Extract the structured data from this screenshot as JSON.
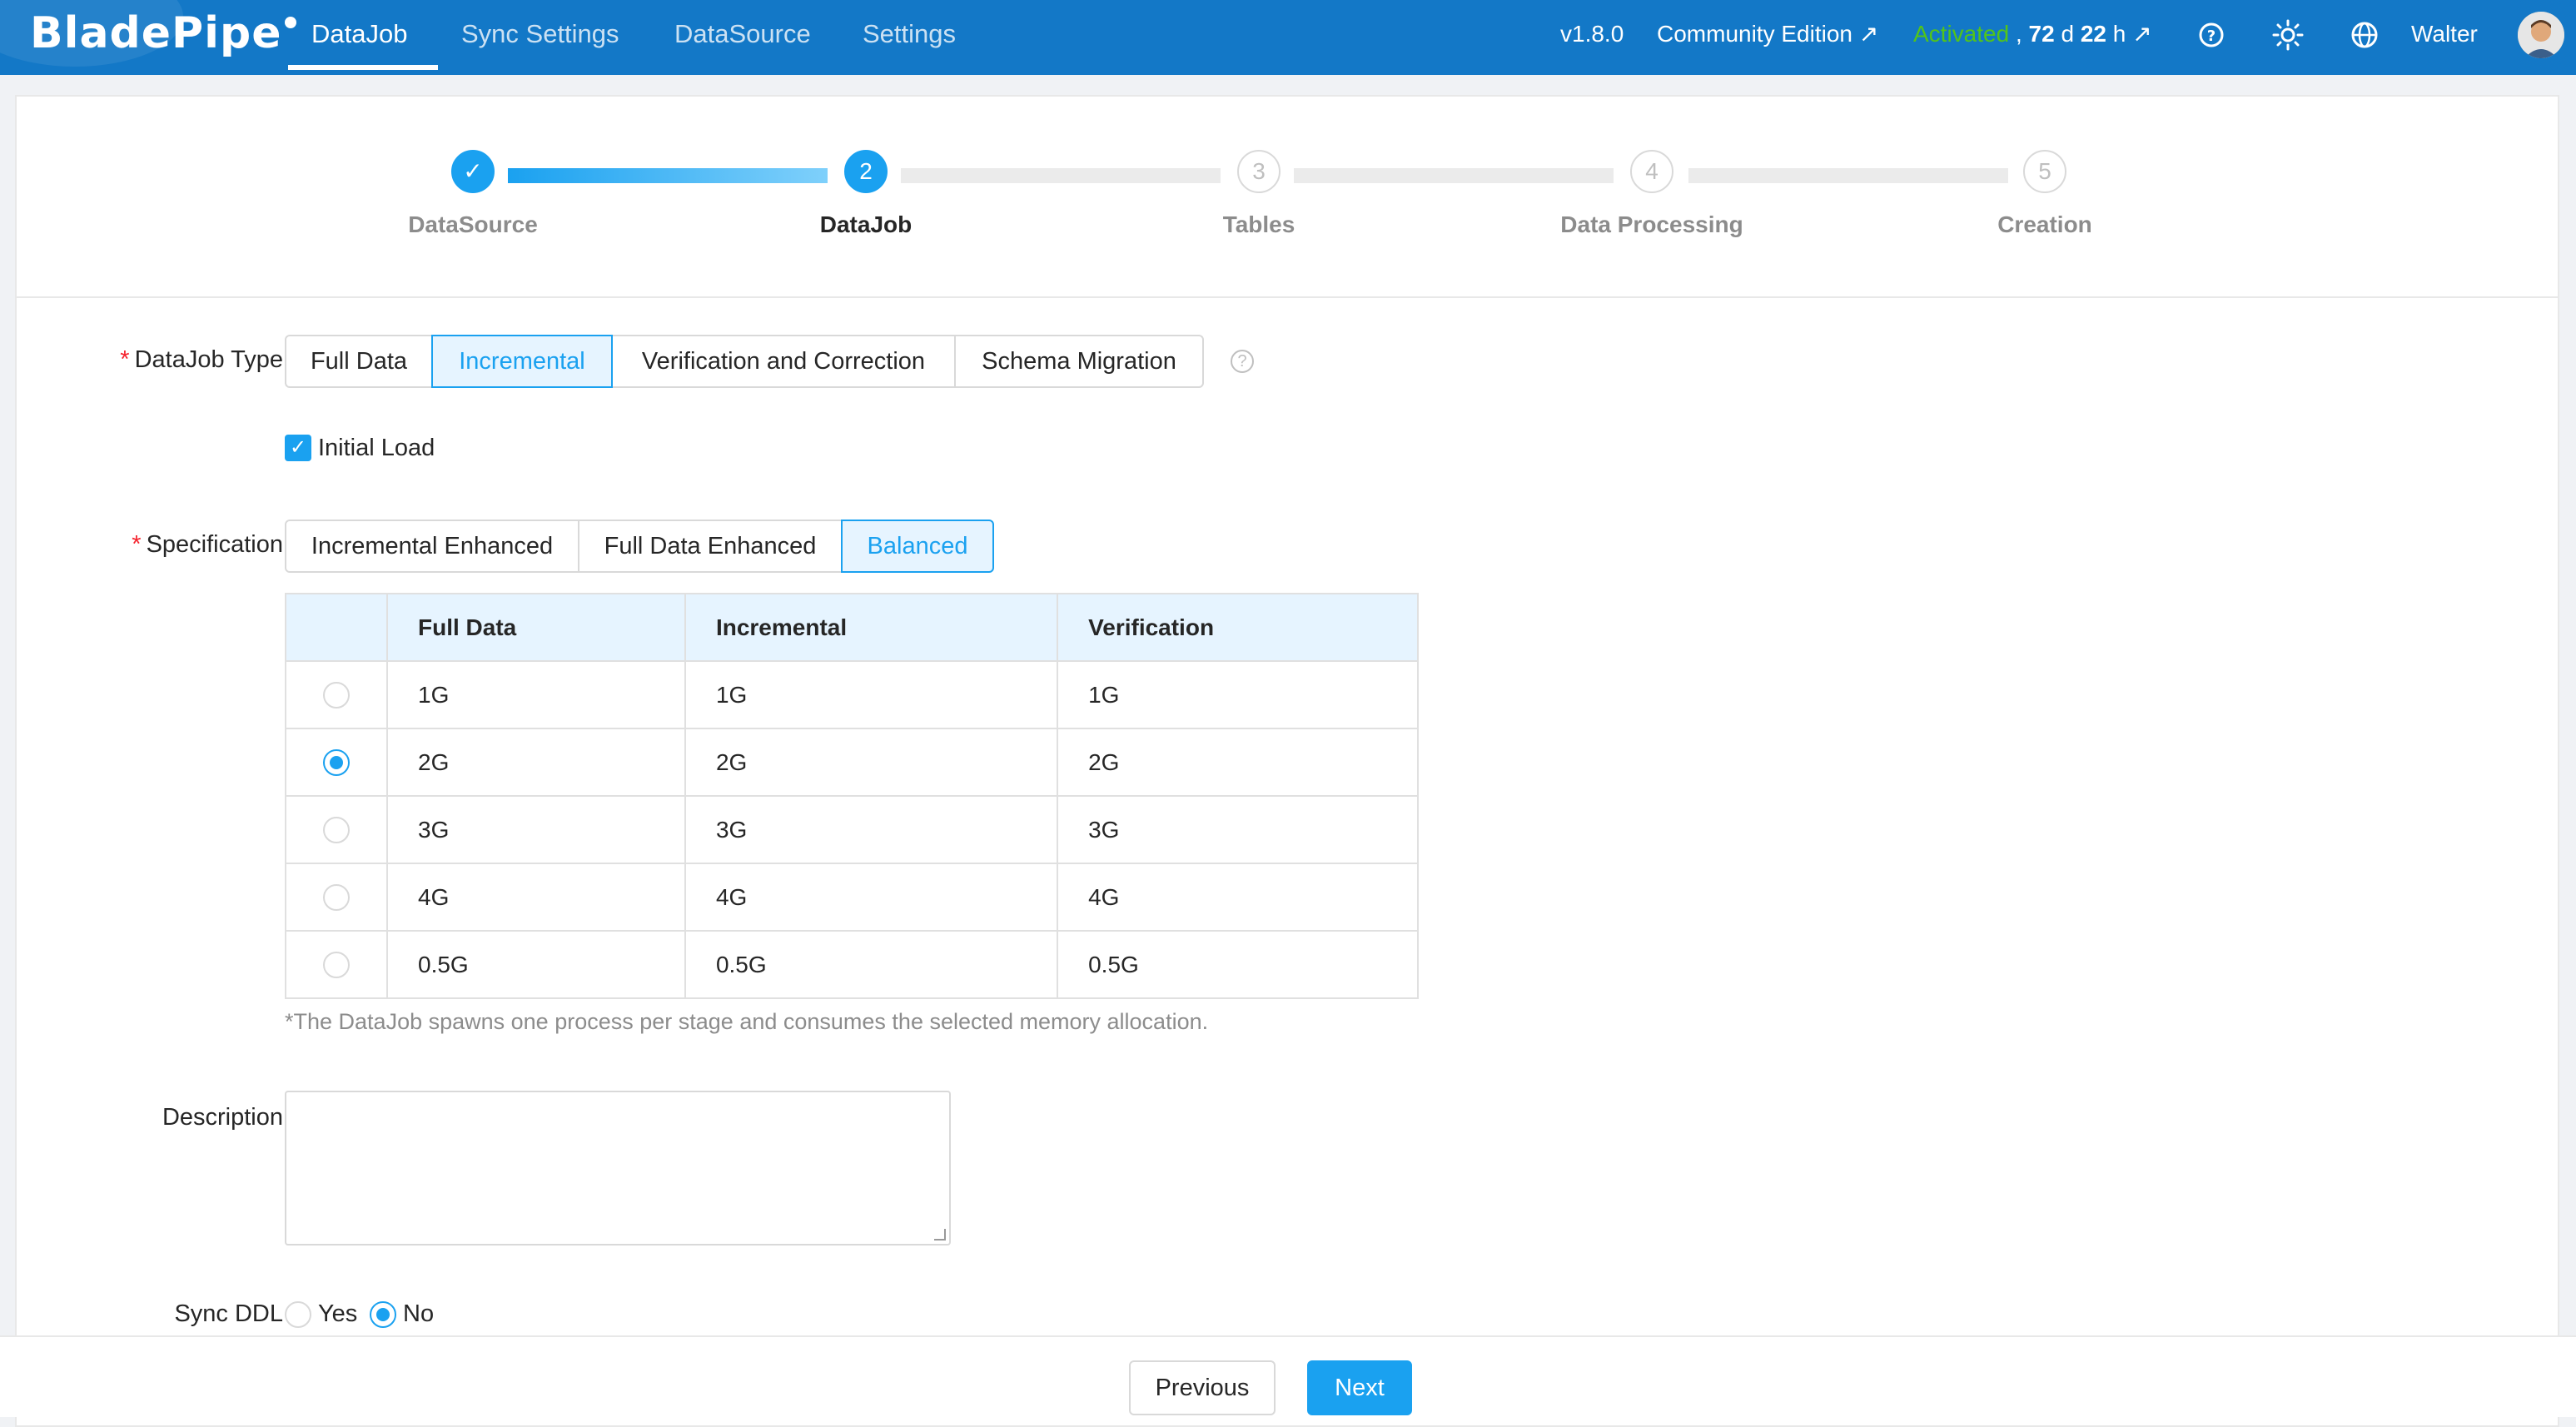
{
  "header": {
    "logo": "BladePipe",
    "nav": [
      "DataJob",
      "Sync Settings",
      "DataSource",
      "Settings"
    ],
    "active_nav": "DataJob",
    "version": "v1.8.0",
    "edition": "Community Edition ↗",
    "activated": "Activated",
    "license_sep": ",",
    "days_value": "72",
    "days_unit": "d",
    "hours_value": "22",
    "hours_unit": "h ↗",
    "user": "Walter",
    "icons": [
      "help-icon",
      "theme-sun-icon",
      "globe-icon"
    ]
  },
  "steps": [
    {
      "label": "DataSource",
      "state": "done",
      "number": "✓"
    },
    {
      "label": "DataJob",
      "state": "current",
      "number": "2"
    },
    {
      "label": "Tables",
      "state": "todo",
      "number": "3"
    },
    {
      "label": "Data Processing",
      "state": "todo",
      "number": "4"
    },
    {
      "label": "Creation",
      "state": "todo",
      "number": "5"
    }
  ],
  "form": {
    "datajob_type": {
      "label": "DataJob Type",
      "options": [
        "Full Data",
        "Incremental",
        "Verification and Correction",
        "Schema Migration"
      ],
      "selected": "Incremental"
    },
    "initial_load": {
      "label": "Initial Load",
      "checked": true
    },
    "specification": {
      "label": "Specification",
      "options": [
        "Incremental Enhanced",
        "Full Data Enhanced",
        "Balanced"
      ],
      "selected": "Balanced",
      "table": {
        "headers": [
          "Full Data",
          "Incremental",
          "Verification"
        ],
        "rows": [
          {
            "selected": false,
            "cells": [
              "1G",
              "1G",
              "1G"
            ]
          },
          {
            "selected": true,
            "cells": [
              "2G",
              "2G",
              "2G"
            ]
          },
          {
            "selected": false,
            "cells": [
              "3G",
              "3G",
              "3G"
            ]
          },
          {
            "selected": false,
            "cells": [
              "4G",
              "4G",
              "4G"
            ]
          },
          {
            "selected": false,
            "cells": [
              "0.5G",
              "0.5G",
              "0.5G"
            ]
          }
        ]
      },
      "hint": "*The DataJob spawns one process per stage and consumes the selected memory allocation."
    },
    "description": {
      "label": "Description",
      "value": ""
    },
    "sync_ddl": {
      "label": "Sync DDL",
      "options": [
        "Yes",
        "No"
      ],
      "selected": "No"
    }
  },
  "footer": {
    "previous": "Previous",
    "next": "Next"
  },
  "colors": {
    "nav_bg": "#1378c7",
    "primary": "#1aa1f0",
    "activated": "#52c41a",
    "required": "#f5222d"
  }
}
